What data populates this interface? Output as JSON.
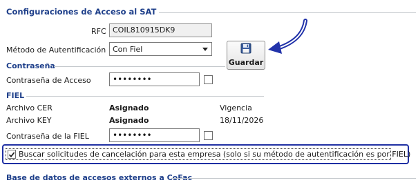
{
  "access_group": {
    "title": "Configuraciones de Acceso al SAT",
    "rfc_label": "RFC",
    "rfc_value": "COIL810915DK9",
    "auth_method_label": "Método de Autentificación",
    "auth_method_value": "Con Fiel",
    "save_button_label": "Guardar"
  },
  "password_section": {
    "title": "Contraseña",
    "access_password_label": "Contraseña de Acceso",
    "access_password_value": "••••••••"
  },
  "fiel_section": {
    "title": "FIEL",
    "cer_label": "Archivo CER",
    "cer_status": "Asignado",
    "validity_label": "Vigencia",
    "key_label": "Archivo KEY",
    "key_status": "Asignado",
    "validity_date": "18/11/2026",
    "fiel_password_label": "Contraseña de la FIEL",
    "fiel_password_value": "••••••••"
  },
  "cancel_option": {
    "checked": true,
    "label": "Buscar solicitudes de cancelación para esta empresa (solo si su método de autentificación es por FIEL)"
  },
  "external_group": {
    "title": "Base de datos de accesos externos a CoFac"
  },
  "colors": {
    "group_title": "#1e3f8a",
    "highlight_border": "#1f2fa3",
    "annotation_arrow": "#2233aa"
  },
  "icons": {
    "save": "floppy-disk-icon",
    "dropdown": "chevron-down-icon",
    "check": "checkmark-icon",
    "annotation": "arrow-icon"
  }
}
